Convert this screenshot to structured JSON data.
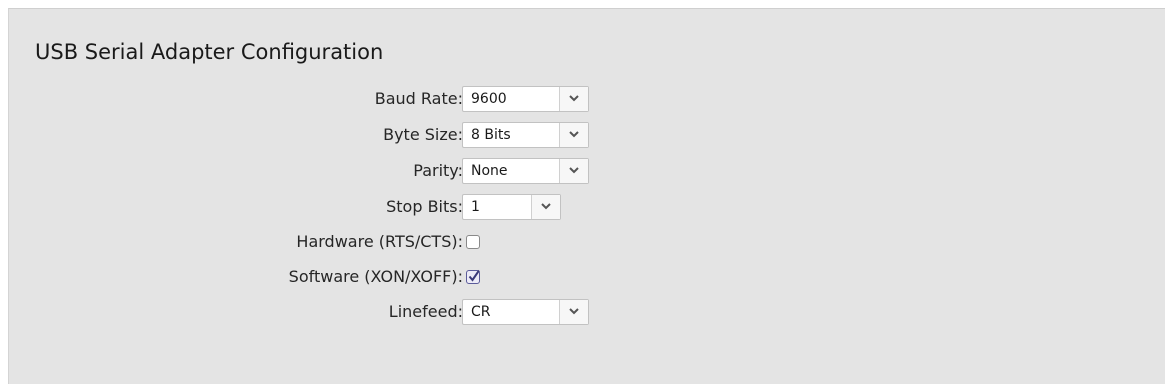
{
  "section": {
    "title": "USB Serial Adapter Configuration"
  },
  "fields": {
    "baud_rate": {
      "label": "Baud Rate:",
      "value": "9600"
    },
    "byte_size": {
      "label": "Byte Size:",
      "value": "8 Bits"
    },
    "parity": {
      "label": "Parity:",
      "value": "None"
    },
    "stop_bits": {
      "label": "Stop Bits:",
      "value": "1"
    },
    "hardware": {
      "label": "Hardware (RTS/CTS):",
      "checked": false
    },
    "software": {
      "label": "Software (XON/XOFF):",
      "checked": true
    },
    "linefeed": {
      "label": "Linefeed:",
      "value": "CR"
    }
  },
  "icons": {
    "dropdown": "chevron-down-icon",
    "check": "checkmark-icon"
  }
}
